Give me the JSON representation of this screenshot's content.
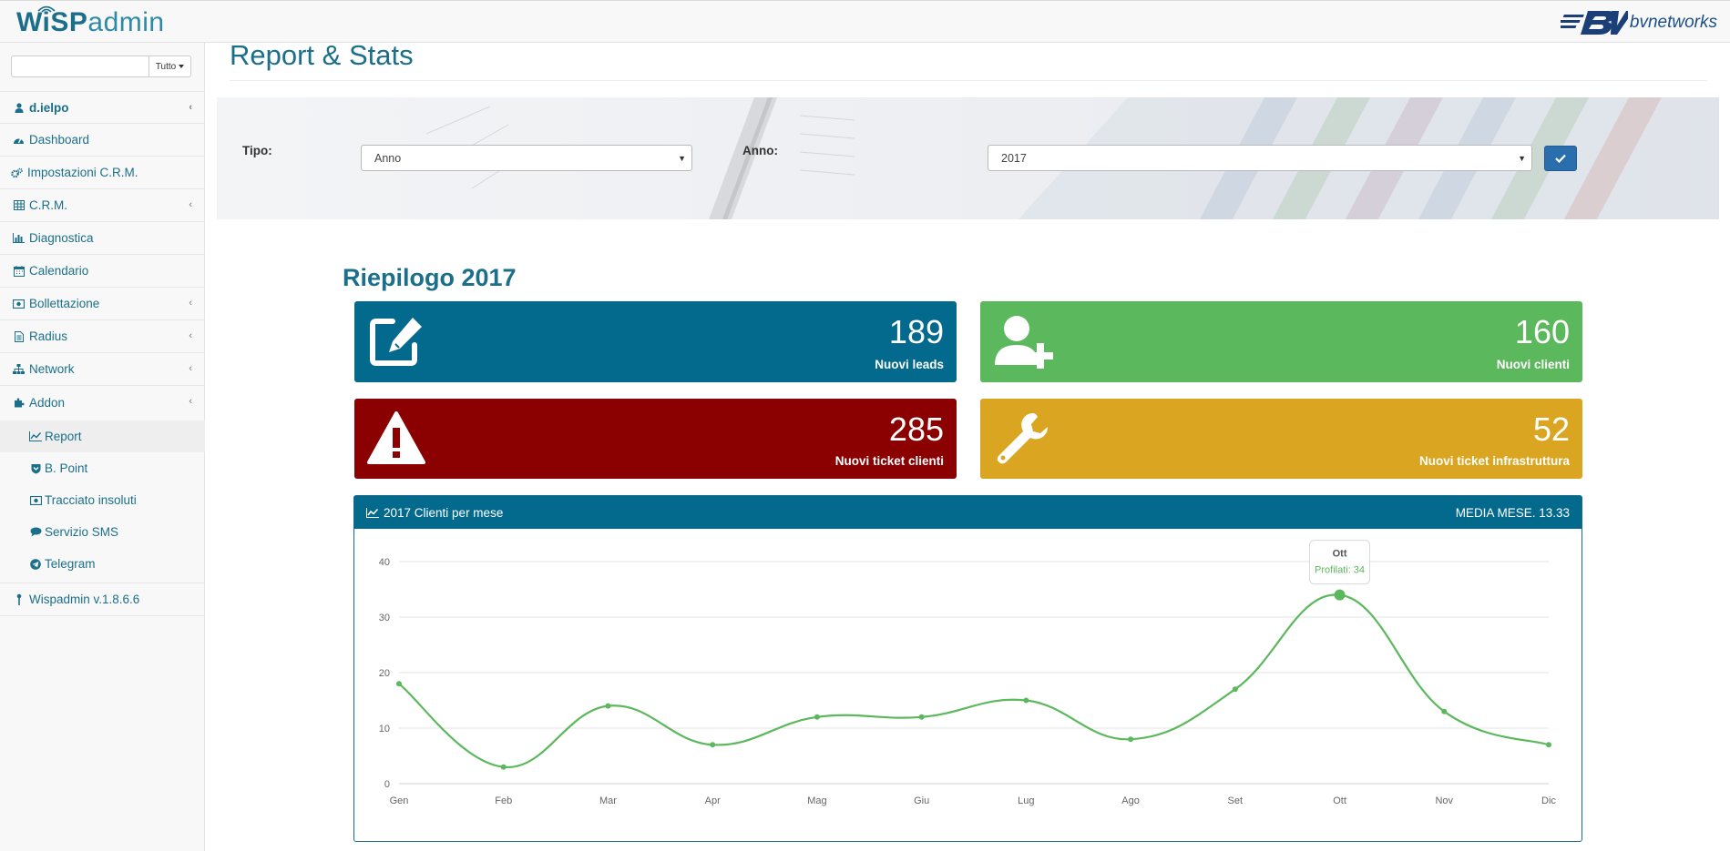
{
  "header": {
    "logo_wisp": "WiSP",
    "logo_admin": "admin",
    "brand": "bvnetworks"
  },
  "sidebar": {
    "search": {
      "value": "",
      "placeholder": ""
    },
    "scope_select": "Tutto",
    "user": "d.ielpo",
    "items": [
      {
        "label": "Dashboard",
        "icon": "dashboard-icon",
        "has_children": false
      },
      {
        "label": "Impostazioni C.R.M.",
        "icon": "cogs-icon",
        "has_children": false
      },
      {
        "label": "C.R.M.",
        "icon": "table-icon",
        "has_children": true
      },
      {
        "label": "Diagnostica",
        "icon": "bar-chart-icon",
        "has_children": false
      },
      {
        "label": "Calendario",
        "icon": "calendar-icon",
        "has_children": false
      },
      {
        "label": "Bollettazione",
        "icon": "money-icon",
        "has_children": true
      },
      {
        "label": "Radius",
        "icon": "file-icon",
        "has_children": true
      },
      {
        "label": "Network",
        "icon": "sitemap-icon",
        "has_children": true
      },
      {
        "label": "Addon",
        "icon": "puzzle-icon",
        "has_children": true
      }
    ],
    "addon_items": [
      {
        "label": "Report",
        "icon": "line-chart-icon",
        "active": true
      },
      {
        "label": "B. Point",
        "icon": "shield-icon",
        "active": false
      },
      {
        "label": "Tracciato insoluti",
        "icon": "money-icon",
        "active": false
      },
      {
        "label": "Servizio SMS",
        "icon": "comments-icon",
        "active": false
      },
      {
        "label": "Telegram",
        "icon": "telegram-icon",
        "active": false
      }
    ],
    "version": "Wispadmin v.1.8.6.6"
  },
  "main": {
    "title": "Report & Stats",
    "filters": {
      "tipo_label": "Tipo:",
      "tipo_value": "Anno",
      "anno_label": "Anno:",
      "anno_value": "2017"
    },
    "summary_title": "Riepilogo 2017",
    "stats": [
      {
        "value": "189",
        "label": "Nuovi leads",
        "color": "#036a8e",
        "icon": "edit-icon"
      },
      {
        "value": "160",
        "label": "Nuovi clienti",
        "color": "#5cb85c",
        "icon": "user-plus-icon"
      },
      {
        "value": "285",
        "label": "Nuovi ticket clienti",
        "color": "#8b0000",
        "icon": "warning-icon"
      },
      {
        "value": "52",
        "label": "Nuovi ticket infrastruttura",
        "color": "#daa520",
        "icon": "wrench-icon"
      }
    ],
    "chart_panel": {
      "title": "2017 Clienti per mese",
      "media": "MEDIA MESE. 13.33"
    }
  },
  "chart_data": {
    "type": "line",
    "title": "2017 Clienti per mese",
    "categories": [
      "Gen",
      "Feb",
      "Mar",
      "Apr",
      "Mag",
      "Giu",
      "Lug",
      "Ago",
      "Set",
      "Ott",
      "Nov",
      "Dic"
    ],
    "series": [
      {
        "name": "Profilati",
        "values": [
          18,
          3,
          14,
          7,
          12,
          12,
          15,
          8,
          17,
          34,
          13,
          7
        ],
        "color": "#5cb85c"
      }
    ],
    "ylim": [
      0,
      40
    ],
    "yticks": [
      0,
      10,
      20,
      30,
      40
    ],
    "grid": true,
    "tooltip": {
      "category": "Ott",
      "text": "Profilati: 34"
    }
  }
}
